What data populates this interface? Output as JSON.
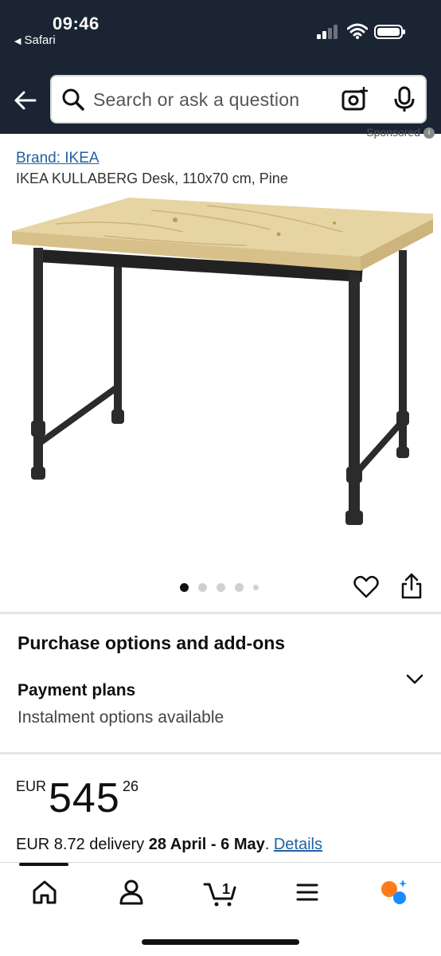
{
  "status": {
    "time": "09:46",
    "back_app": "Safari"
  },
  "search": {
    "placeholder": "Search or ask a question"
  },
  "product": {
    "sponsored": "Sponsored",
    "brand": "Brand: IKEA",
    "title": "IKEA KULLABERG Desk, 110x70 cm, Pine",
    "image_count": 5,
    "active_image": 1
  },
  "purchase": {
    "section_title": "Purchase options and add-ons",
    "plans_title": "Payment plans",
    "plans_sub": "Instalment options available"
  },
  "price": {
    "currency": "EUR",
    "whole": "545",
    "fraction": "26"
  },
  "delivery": {
    "prefix": "EUR 8.72 delivery ",
    "dates": "28 April - 6 May",
    "suffix": ". ",
    "details": "Details"
  },
  "tabs": [
    {
      "name": "home-icon"
    },
    {
      "name": "account-icon"
    },
    {
      "name": "cart-icon",
      "count": "1"
    },
    {
      "name": "menu-icon"
    },
    {
      "name": "rufus-ai-icon"
    }
  ],
  "colors": {
    "header": "#1a2432",
    "link": "#2162a1",
    "accent": "#ff7a1a",
    "ai_blue": "#1a8cff"
  }
}
